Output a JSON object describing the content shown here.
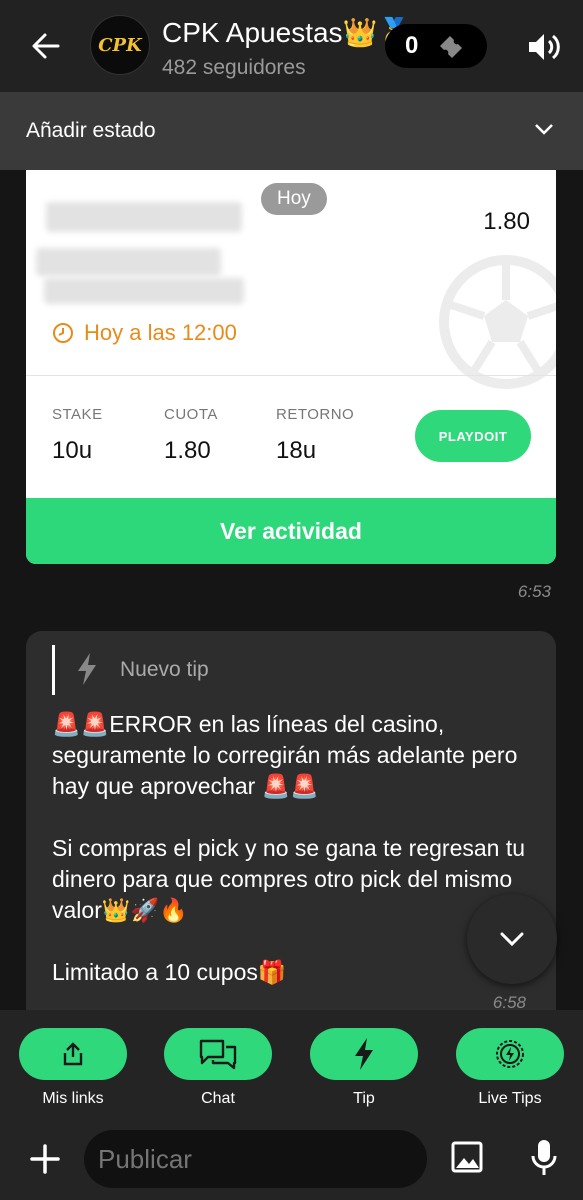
{
  "header": {
    "title": "CPK Apuestas👑🥇",
    "avatar_text": "CPK",
    "followers": "482 seguidores",
    "counter": "0"
  },
  "status": {
    "label": "Añadir estado"
  },
  "bet_card": {
    "date_pill": "Hoy",
    "odds": "1.80",
    "time": "Hoy a las 12:00",
    "stats": [
      {
        "key": "STAKE",
        "value": "10u"
      },
      {
        "key": "CUOTA",
        "value": "1.80"
      },
      {
        "key": "RETORNO",
        "value": "18u"
      }
    ],
    "playdoit_label": "PLAYDOIT",
    "activity_label": "Ver actividad",
    "timestamp": "6:53"
  },
  "tip": {
    "label": "Nuevo tip",
    "line1": "🚨🚨ERROR en las líneas del casino, seguramente lo corregirán más adelante pero hay que aprovechar 🚨🚨",
    "line2": "Si compras el pick y no se gana te regresan tu dinero para que compres otro pick del mismo valor👑🚀🔥",
    "line3": "Limitado a 10 cupos🎁",
    "timestamp": "6:58"
  },
  "actions": [
    {
      "label": "Mis links",
      "icon": "share-icon"
    },
    {
      "label": "Chat",
      "icon": "chat-icon"
    },
    {
      "label": "Tip",
      "icon": "lightning-icon"
    },
    {
      "label": "Live Tips",
      "icon": "live-lightning-icon"
    }
  ],
  "composer": {
    "placeholder": "Publicar"
  },
  "colors": {
    "accent": "#2fd87a",
    "time": "#e88b1a",
    "background": "#151515"
  }
}
